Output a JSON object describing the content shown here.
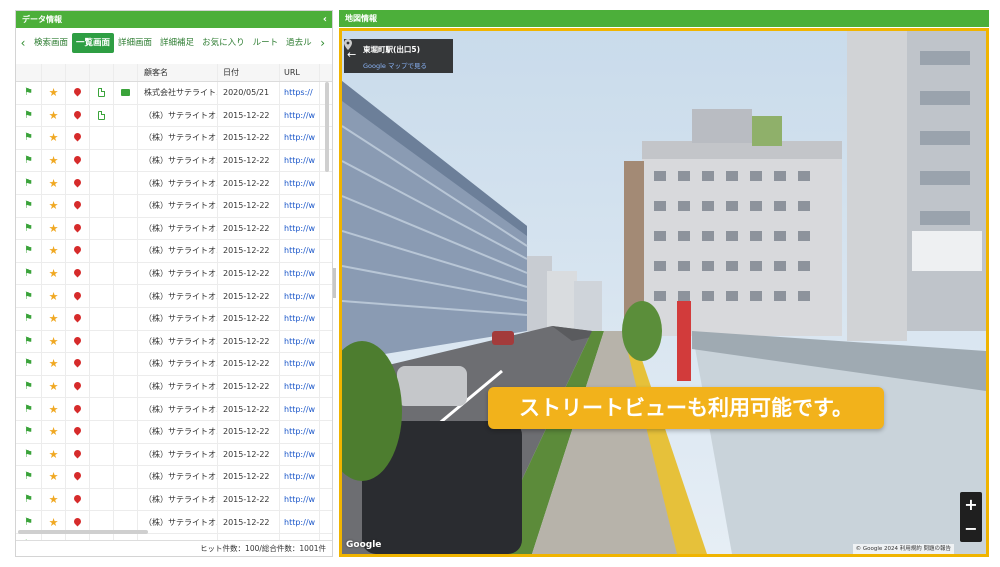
{
  "left_panel": {
    "title": "データ情報",
    "collapse_icon": "chevron-left-icon",
    "tabs": [
      "検索画面",
      "一覧画面",
      "詳細画面",
      "詳細補足",
      "お気に入り",
      "ルート",
      "過去ル"
    ],
    "active_tab": "一覧画面",
    "columns": [
      "顧客名",
      "日付",
      "URL"
    ],
    "rows": [
      {
        "name": "株式会社サテライト…",
        "date": "2020/05/21",
        "url": "https://",
        "doc": true,
        "chat": true
      },
      {
        "name": "（株）サテライトオ…",
        "date": "2015-12-22",
        "url": "http://w",
        "doc": true,
        "chat": false
      },
      {
        "name": "（株）サテライトオ…",
        "date": "2015-12-22",
        "url": "http://w",
        "doc": false,
        "chat": false
      },
      {
        "name": "（株）サテライトオ…",
        "date": "2015-12-22",
        "url": "http://w",
        "doc": false,
        "chat": false
      },
      {
        "name": "（株）サテライトオ…",
        "date": "2015-12-22",
        "url": "http://w",
        "doc": false,
        "chat": false
      },
      {
        "name": "（株）サテライトオ…",
        "date": "2015-12-22",
        "url": "http://w",
        "doc": false,
        "chat": false
      },
      {
        "name": "（株）サテライトオ…",
        "date": "2015-12-22",
        "url": "http://w",
        "doc": false,
        "chat": false
      },
      {
        "name": "（株）サテライトオ…",
        "date": "2015-12-22",
        "url": "http://w",
        "doc": false,
        "chat": false
      },
      {
        "name": "（株）サテライトオ…",
        "date": "2015-12-22",
        "url": "http://w",
        "doc": false,
        "chat": false
      },
      {
        "name": "（株）サテライトオ…",
        "date": "2015-12-22",
        "url": "http://w",
        "doc": false,
        "chat": false
      },
      {
        "name": "（株）サテライトオ…",
        "date": "2015-12-22",
        "url": "http://w",
        "doc": false,
        "chat": false
      },
      {
        "name": "（株）サテライトオ…",
        "date": "2015-12-22",
        "url": "http://w",
        "doc": false,
        "chat": false
      },
      {
        "name": "（株）サテライトオ…",
        "date": "2015-12-22",
        "url": "http://w",
        "doc": false,
        "chat": false
      },
      {
        "name": "（株）サテライトオ…",
        "date": "2015-12-22",
        "url": "http://w",
        "doc": false,
        "chat": false
      },
      {
        "name": "（株）サテライトオ…",
        "date": "2015-12-22",
        "url": "http://w",
        "doc": false,
        "chat": false
      },
      {
        "name": "（株）サテライトオ…",
        "date": "2015-12-22",
        "url": "http://w",
        "doc": false,
        "chat": false
      },
      {
        "name": "（株）サテライトオ…",
        "date": "2015-12-22",
        "url": "http://w",
        "doc": false,
        "chat": false
      },
      {
        "name": "（株）サテライトオ…",
        "date": "2015-12-22",
        "url": "http://w",
        "doc": false,
        "chat": false
      },
      {
        "name": "（株）サテライトオ…",
        "date": "2015-12-22",
        "url": "http://w",
        "doc": false,
        "chat": false
      },
      {
        "name": "（株）サテライトオ…",
        "date": "2015-12-22",
        "url": "http://w",
        "doc": false,
        "chat": false
      },
      {
        "name": "（株）サテライトオ…",
        "date": "2015-12-22",
        "url": "http://w",
        "doc": false,
        "chat": false
      }
    ],
    "footer": "ヒット件数：100/総合件数：1001件"
  },
  "right_panel": {
    "title": "地図情報",
    "place_name": "東堀町駅(出口5)",
    "map_link": "Google マップで見る",
    "caption": "ストリートビューも利用可能です。",
    "zoom_in": "+",
    "zoom_out": "−",
    "google_logo": "Google",
    "map_footer": "© Google 2024 利用規約 問題の報告"
  },
  "colors": {
    "header_green": "#4caf3a",
    "active_tab": "#2e9e43",
    "highlight_border": "#f0b400",
    "caption_bg": "#f2b21b"
  }
}
